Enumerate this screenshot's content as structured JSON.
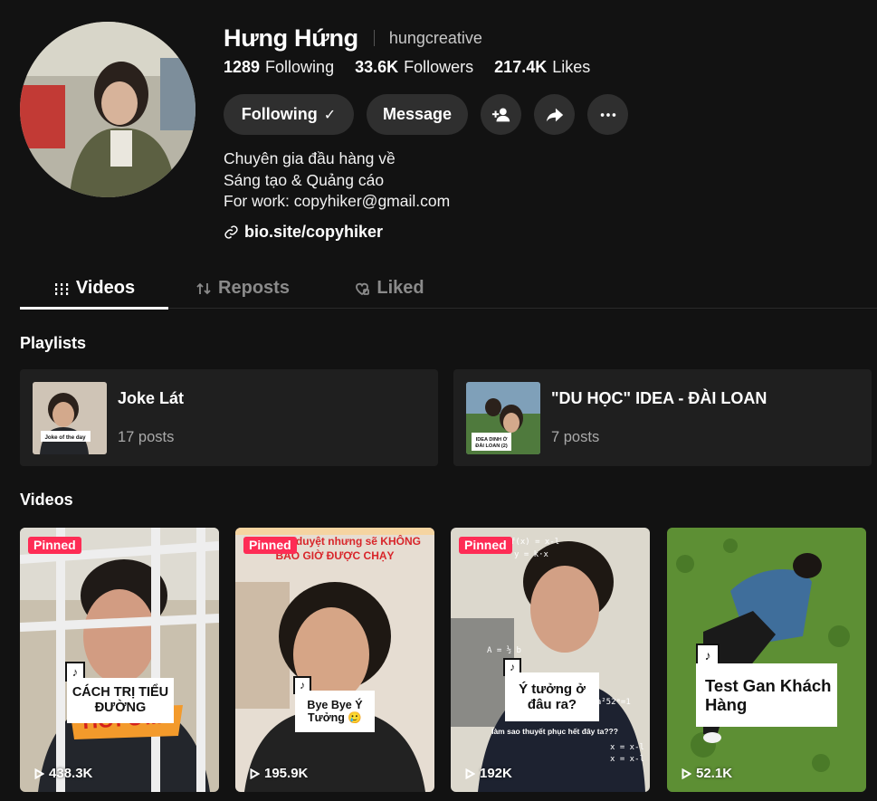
{
  "profile": {
    "display_name": "Hưng Hứng",
    "username": "hungcreative",
    "stats": [
      {
        "num": "1289",
        "label": "Following"
      },
      {
        "num": "33.6K",
        "label": "Followers"
      },
      {
        "num": "217.4K",
        "label": "Likes"
      }
    ],
    "buttons": {
      "following": "Following",
      "message": "Message"
    },
    "bio": [
      "Chuyên gia đầu hàng về",
      "Sáng tạo & Quảng cáo",
      "For work: copyhiker@gmail.com"
    ],
    "link": "bio.site/copyhiker"
  },
  "tabs": [
    {
      "label": "Videos",
      "icon": "grid-icon",
      "active": true
    },
    {
      "label": "Reposts",
      "icon": "repost-icon",
      "active": false
    },
    {
      "label": "Liked",
      "icon": "heart-icon",
      "active": false
    }
  ],
  "playlists_title": "Playlists",
  "playlists": [
    {
      "title": "Joke Lát",
      "count": "17 posts",
      "thumb_caption": "Joke of the day"
    },
    {
      "title": "\"DU HỌC\" IDEA - ĐÀI LOAN",
      "count": "7 posts",
      "thumb_caption": "IDEA DINH Ở ĐÀI LOAN (2)"
    }
  ],
  "videos_title": "Videos",
  "videos": [
    {
      "pinned": "Pinned",
      "views": "438.3K",
      "caption": "CÁCH TRỊ TIỂU ĐƯỜNG",
      "extra": "HƠI ƠI..!"
    },
    {
      "pinned": "Pinned",
      "views": "195.9K",
      "caption": "Bye Bye Ý Tưởng 🥲",
      "top_text": "đã được duyệt nhưng sẽ KHÔNG BAO GIỜ ĐƯỢC CHẠY"
    },
    {
      "pinned": "Pinned",
      "views": "192K",
      "caption": "Ý tưởng ở đâu ra?",
      "sub": "làm sao thuyết phục hết đây ta???"
    },
    {
      "pinned": "",
      "views": "52.1K",
      "caption": "Test Gan Khách Hàng"
    }
  ]
}
